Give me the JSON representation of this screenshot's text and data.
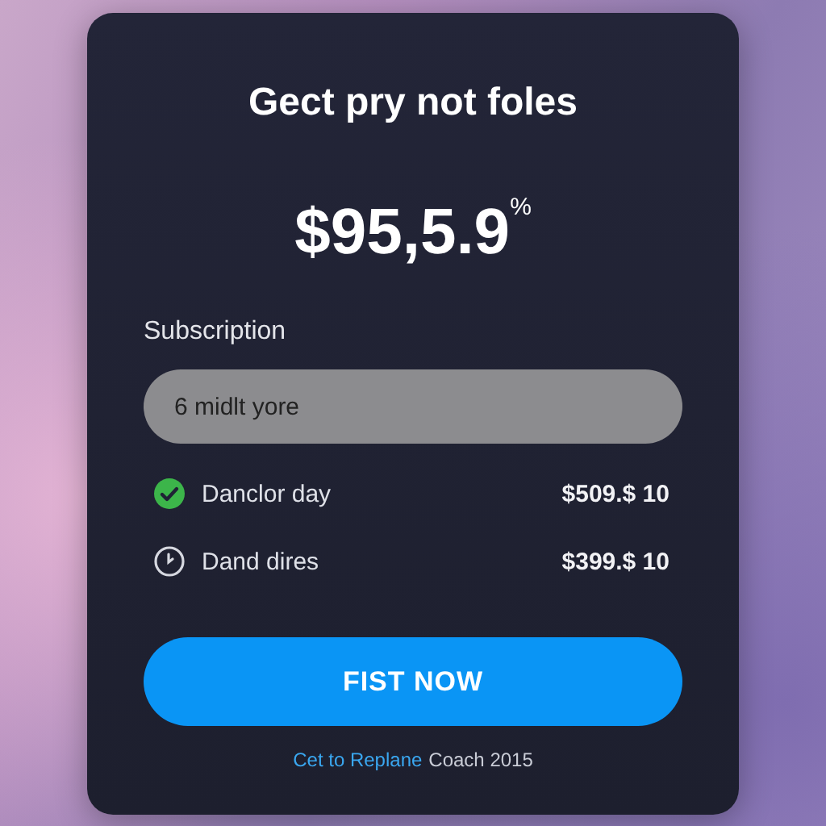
{
  "title": "Gect pry not foles",
  "price": "$95,5.9$^{%}$",
  "subscription": {
    "label": "Subscription",
    "value": "6 midlt yore"
  },
  "features": [
    {
      "kind": "check",
      "label": "Danclor day",
      "price": "$509.$ 10"
    },
    {
      "kind": "clock",
      "label": "Dand dires",
      "price": "$399.$ 10"
    }
  ],
  "button": "FIST NOW",
  "footer": {
    "link": "Cet to Replane",
    "text": "Coach 2015"
  }
}
